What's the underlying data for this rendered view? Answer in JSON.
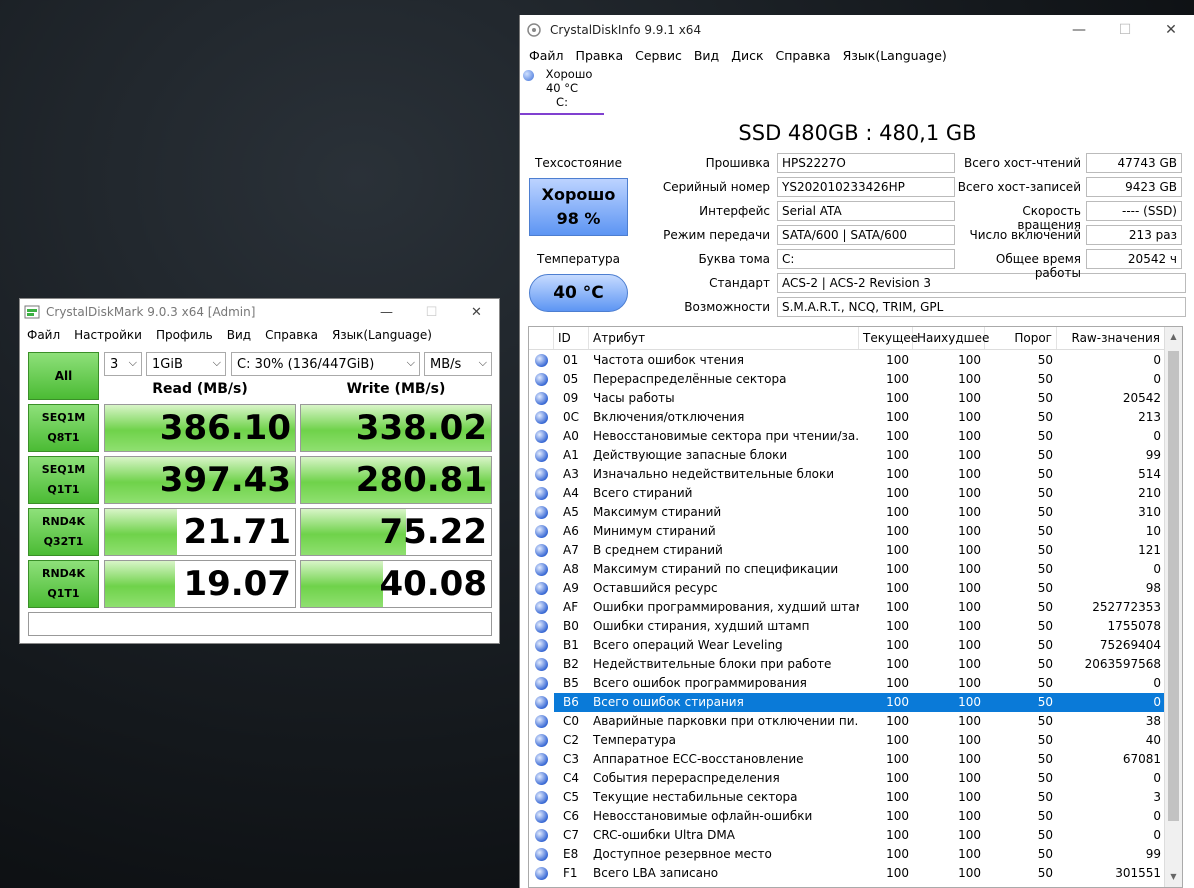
{
  "cdm": {
    "title": "CrystalDiskMark 9.0.3 x64 [Admin]",
    "menu": [
      "Файл",
      "Настройки",
      "Профиль",
      "Вид",
      "Справка",
      "Язык(Language)"
    ],
    "all_label": "All",
    "count": "3",
    "size": "1GiB",
    "drive": "C: 30% (136/447GiB)",
    "unit": "MB/s",
    "read_header": "Read (MB/s)",
    "write_header": "Write (MB/s)",
    "tests": [
      {
        "l1": "SEQ1M",
        "l2": "Q8T1",
        "read": "386.10",
        "write": "338.02",
        "rf": 1.0,
        "wf": 1.0
      },
      {
        "l1": "SEQ1M",
        "l2": "Q1T1",
        "read": "397.43",
        "write": "280.81",
        "rf": 1.0,
        "wf": 1.0
      },
      {
        "l1": "RND4K",
        "l2": "Q32T1",
        "read": "21.71",
        "write": "75.22",
        "rf": 0.38,
        "wf": 0.55
      },
      {
        "l1": "RND4K",
        "l2": "Q1T1",
        "read": "19.07",
        "write": "40.08",
        "rf": 0.37,
        "wf": 0.43
      }
    ],
    "status": ""
  },
  "cdi": {
    "title": "CrystalDiskInfo 9.9.1 x64",
    "menu": [
      "Файл",
      "Правка",
      "Сервис",
      "Вид",
      "Диск",
      "Справка",
      "Язык(Language)"
    ],
    "tab": {
      "status": "Хорошо",
      "temp": "40 °C",
      "drive": "C:"
    },
    "model": "SSD 480GB : 480,1 GB",
    "health_label": "Техсостояние",
    "health_status": "Хорошо",
    "health_pct": "98 %",
    "temp_label": "Температура",
    "temp_value": "40 °C",
    "info_left": [
      {
        "k": "Прошивка",
        "v": "HPS2227O"
      },
      {
        "k": "Серийный номер",
        "v": "YS202010233426HP"
      },
      {
        "k": "Интерфейс",
        "v": "Serial ATA"
      },
      {
        "k": "Режим передачи",
        "v": "SATA/600 | SATA/600"
      },
      {
        "k": "Буква тома",
        "v": "C:"
      },
      {
        "k": "Стандарт",
        "v": "ACS-2 | ACS-2 Revision 3"
      },
      {
        "k": "Возможности",
        "v": "S.M.A.R.T., NCQ, TRIM, GPL"
      }
    ],
    "info_right": [
      {
        "k": "Всего хост-чтений",
        "v": "47743 GB"
      },
      {
        "k": "Всего хост-записей",
        "v": "9423 GB"
      },
      {
        "k": "Скорость вращения",
        "v": "---- (SSD)"
      },
      {
        "k": "Число включений",
        "v": "213 раз"
      },
      {
        "k": "Общее время работы",
        "v": "20542 ч"
      }
    ],
    "columns": [
      "",
      "ID",
      "Атрибут",
      "Текущее",
      "Наихудшее",
      "Порог",
      "Raw-значения"
    ],
    "rows": [
      [
        "01",
        "Частота ошибок чтения",
        "100",
        "100",
        "50",
        "0"
      ],
      [
        "05",
        "Перераспределённые сектора",
        "100",
        "100",
        "50",
        "0"
      ],
      [
        "09",
        "Часы работы",
        "100",
        "100",
        "50",
        "20542"
      ],
      [
        "0C",
        "Включения/отключения",
        "100",
        "100",
        "50",
        "213"
      ],
      [
        "A0",
        "Невосстановимые сектора при чтении/за...",
        "100",
        "100",
        "50",
        "0"
      ],
      [
        "A1",
        "Действующие запасные блоки",
        "100",
        "100",
        "50",
        "99"
      ],
      [
        "A3",
        "Изначально недействительные блоки",
        "100",
        "100",
        "50",
        "514"
      ],
      [
        "A4",
        "Всего стираний",
        "100",
        "100",
        "50",
        "210"
      ],
      [
        "A5",
        "Максимум стираний",
        "100",
        "100",
        "50",
        "310"
      ],
      [
        "A6",
        "Минимум стираний",
        "100",
        "100",
        "50",
        "10"
      ],
      [
        "A7",
        "В среднем стираний",
        "100",
        "100",
        "50",
        "121"
      ],
      [
        "A8",
        "Максимум стираний по спецификации",
        "100",
        "100",
        "50",
        "0"
      ],
      [
        "A9",
        "Оставшийся ресурс",
        "100",
        "100",
        "50",
        "98"
      ],
      [
        "AF",
        "Ошибки программирования, худший штам...",
        "100",
        "100",
        "50",
        "252772353"
      ],
      [
        "B0",
        "Ошибки стирания, худший штамп",
        "100",
        "100",
        "50",
        "1755078"
      ],
      [
        "B1",
        "Всего операций Wear Leveling",
        "100",
        "100",
        "50",
        "75269404"
      ],
      [
        "B2",
        "Недействительные блоки при работе",
        "100",
        "100",
        "50",
        "2063597568"
      ],
      [
        "B5",
        "Всего ошибок программирования",
        "100",
        "100",
        "50",
        "0"
      ],
      [
        "B6",
        "Всего ошибок стирания",
        "100",
        "100",
        "50",
        "0"
      ],
      [
        "C0",
        "Аварийные парковки при отключении пи...",
        "100",
        "100",
        "50",
        "38"
      ],
      [
        "C2",
        "Температура",
        "100",
        "100",
        "50",
        "40"
      ],
      [
        "C3",
        "Аппаратное ECC-восстановление",
        "100",
        "100",
        "50",
        "67081"
      ],
      [
        "C4",
        "События перераспределения",
        "100",
        "100",
        "50",
        "0"
      ],
      [
        "C5",
        "Текущие нестабильные сектора",
        "100",
        "100",
        "50",
        "3"
      ],
      [
        "C6",
        "Невосстановимые офлайн-ошибки",
        "100",
        "100",
        "50",
        "0"
      ],
      [
        "C7",
        "CRC-ошибки Ultra DMA",
        "100",
        "100",
        "50",
        "0"
      ],
      [
        "E8",
        "Доступное резервное место",
        "100",
        "100",
        "50",
        "99"
      ],
      [
        "F1",
        "Всего LBA записано",
        "100",
        "100",
        "50",
        "301551"
      ]
    ],
    "selected_row": 18
  }
}
